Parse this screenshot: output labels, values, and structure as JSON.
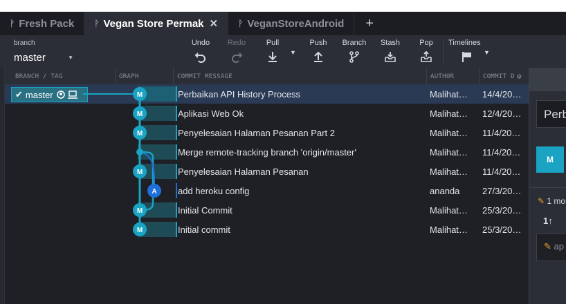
{
  "tabs": [
    {
      "label": "Fresh Pack",
      "active": false
    },
    {
      "label": "Vegan Store Permak",
      "active": true,
      "close": "✕"
    },
    {
      "label": "VeganStoreAndroid",
      "active": false
    }
  ],
  "add_tab": "+",
  "toolbar": {
    "branch_label": "branch",
    "branch_value": "master",
    "undo": "Undo",
    "redo": "Redo",
    "pull": "Pull",
    "push": "Push",
    "branch": "Branch",
    "stash": "Stash",
    "pop": "Pop",
    "timelines": "Timelines"
  },
  "columns": {
    "branch_tag": "BRANCH / TAG",
    "graph": "GRAPH",
    "message": "COMMIT MESSAGE",
    "author": "AUTHOR",
    "date": "COMMIT D"
  },
  "branch_tag": {
    "name": "master"
  },
  "commits": [
    {
      "avatar": "M",
      "message": "Perbaikan API History Process",
      "author": "Malihat…",
      "date": "14/4/20…",
      "selected": true
    },
    {
      "avatar": "M",
      "message": "Aplikasi Web Ok",
      "author": "Malihat…",
      "date": "12/4/20…"
    },
    {
      "avatar": "M",
      "message": "Penyelesaian Halaman Pesanan Part 2",
      "author": "Malihat…",
      "date": "11/4/20…"
    },
    {
      "avatar": "",
      "message": "Merge remote-tracking branch 'origin/master'",
      "author": "Malihat…",
      "date": "11/4/20…"
    },
    {
      "avatar": "M",
      "message": "Penyelesaian Halaman Pesanan",
      "author": "Malihat…",
      "date": "11/4/20…"
    },
    {
      "avatar": "A",
      "message": "add heroku config",
      "author": "ananda",
      "date": "27/3/20…"
    },
    {
      "avatar": "M",
      "message": "Initial Commit",
      "author": "Malihat…",
      "date": "25/3/20…"
    },
    {
      "avatar": "M",
      "message": "Initial commit",
      "author": "Malihat…",
      "date": "25/3/20…"
    }
  ],
  "details": {
    "title": "Perb",
    "avatar": "M",
    "changes": "1 mo",
    "sort_icon": "1↑",
    "file": "ap"
  },
  "colors": {
    "accent": "#1aa3c3",
    "branch_blue": "#1e6fd9",
    "selected_row": "#2a3a55",
    "background": "#1e2026"
  }
}
